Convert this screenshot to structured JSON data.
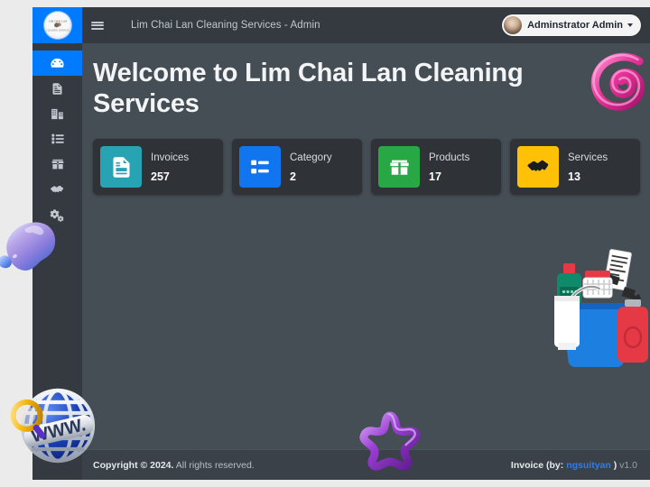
{
  "brand": {
    "logo_icon": "company-logo-circle",
    "accent_color": "#007bff"
  },
  "sidebar": {
    "items": [
      {
        "icon": "dashboard-tachometer-icon",
        "name": "dashboard",
        "active": true
      },
      {
        "icon": "invoice-file-icon",
        "name": "invoices",
        "active": false
      },
      {
        "icon": "building-company-icon",
        "name": "company",
        "active": false
      },
      {
        "icon": "list-icon",
        "name": "category",
        "active": false
      },
      {
        "icon": "box-product-icon",
        "name": "products",
        "active": false
      },
      {
        "icon": "handshake-icon",
        "name": "services",
        "active": false
      },
      {
        "icon": "gears-settings-icon",
        "name": "settings",
        "active": false
      }
    ]
  },
  "topbar": {
    "menu_icon": "hamburger-menu-icon",
    "title": "Lim Chai Lan Cleaning Services - Admin",
    "user": {
      "name": "Adminstrator Admin",
      "avatar_icon": "user-avatar",
      "caret_icon": "chevron-down-icon"
    }
  },
  "main": {
    "page_title": "Welcome to Lim Chai Lan Cleaning Services",
    "cards": [
      {
        "label": "Invoices",
        "value": "257",
        "color": "#27a3b4",
        "icon": "invoice-file-icon"
      },
      {
        "label": "Category",
        "value": "2",
        "color": "#1275f0",
        "icon": "list-icon"
      },
      {
        "label": "Products",
        "value": "17",
        "color": "#28a745",
        "icon": "box-product-icon"
      },
      {
        "label": "Services",
        "value": "13",
        "color": "#ffc107",
        "icon": "handshake-icon"
      }
    ]
  },
  "footer": {
    "copyright_bold": "Copyright © 2024.",
    "copyright_rest": " All rights reserved.",
    "app_label": "Invoice (by:",
    "author": "ngsuityan",
    "close_paren": ")",
    "version": "v1.0"
  },
  "decorations": [
    {
      "name": "pink-spiral-3d",
      "color": "#e8339a"
    },
    {
      "name": "blue-purple-blob-3d",
      "color": "#8f9ff0"
    },
    {
      "name": "www-globe-3d",
      "color": "#1a3fb4"
    },
    {
      "name": "purple-star-3d",
      "color": "#8a35c9"
    },
    {
      "name": "cleaning-supplies-illustration",
      "color": "#1d7fe0"
    }
  ]
}
